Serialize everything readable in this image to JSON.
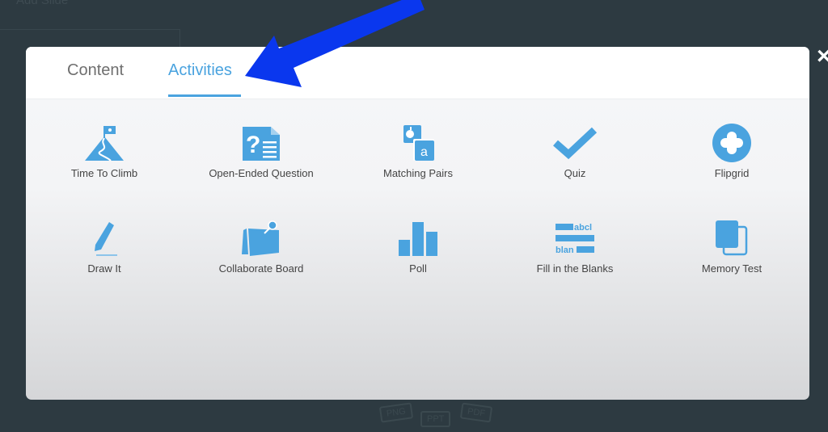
{
  "background": {
    "title": "Add Slide",
    "filetypes": [
      "PNG",
      "PPT",
      "PDF"
    ]
  },
  "modal": {
    "tabs": [
      {
        "label": "Content",
        "active": false
      },
      {
        "label": "Activities",
        "active": true
      }
    ],
    "close_label": "×",
    "accent_color": "#4aa3df",
    "annotation_arrow_color": "#0033ee",
    "activities": [
      {
        "label": "Time To Climb",
        "icon": "mountain-flag-icon"
      },
      {
        "label": "Open-Ended Question",
        "icon": "question-document-icon"
      },
      {
        "label": "Matching Pairs",
        "icon": "matching-cards-icon"
      },
      {
        "label": "Quiz",
        "icon": "checkmark-icon"
      },
      {
        "label": "Flipgrid",
        "icon": "flipgrid-plus-icon"
      },
      {
        "label": "Draw It",
        "icon": "pencil-icon"
      },
      {
        "label": "Collaborate Board",
        "icon": "pinned-board-icon"
      },
      {
        "label": "Poll",
        "icon": "bar-chart-icon"
      },
      {
        "label": "Fill in the Blanks",
        "icon": "fill-blanks-icon"
      },
      {
        "label": "Memory Test",
        "icon": "memory-cards-icon"
      }
    ],
    "icon_text": {
      "matching_letter": "a",
      "fill_top": "abcl",
      "fill_bottom": "blan"
    }
  }
}
